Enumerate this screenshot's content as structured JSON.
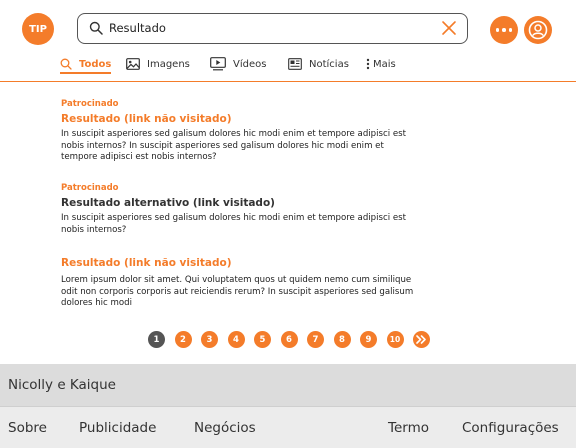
{
  "header": {
    "logo_text": "TIP",
    "search": {
      "value": "Resultado"
    }
  },
  "tabs": [
    {
      "label": "Todos",
      "icon": "search-icon",
      "active": true
    },
    {
      "label": "Imagens",
      "icon": "image-icon",
      "active": false
    },
    {
      "label": "Vídeos",
      "icon": "video-icon",
      "active": false
    },
    {
      "label": "Notícias",
      "icon": "news-icon",
      "active": false
    },
    {
      "label": "Mais",
      "icon": "kebab-icon",
      "active": false
    }
  ],
  "results": [
    {
      "sponsored": "Patrocinado",
      "title": "Resultado (link não visitado)",
      "description": "In suscipit asperiores sed galisum dolores hic modi enim et tempore adipisci est nobis internos? In suscipit asperiores sed galisum dolores hic modi enim et tempore adipisci est nobis internos?"
    },
    {
      "sponsored": "Patrocinado",
      "title": "Resultado alternativo (link visitado)",
      "description": "In suscipit asperiores sed galisum dolores hic modi enim et tempore adipisci est nobis internos?"
    },
    {
      "sponsored": "",
      "title": "Resultado (link não visitado)",
      "description": "Lorem ipsum dolor sit amet. Qui voluptatem quos ut quidem nemo cum similique odit non corporis corporis aut reiciendis rerum? In suscipit asperiores sed galisum dolores hic modi"
    }
  ],
  "pagination": {
    "pages": [
      "1",
      "2",
      "3",
      "4",
      "5",
      "6",
      "7",
      "8",
      "9",
      "10"
    ],
    "current": "1",
    "next_icon": "double-chevron-right-icon"
  },
  "footer": {
    "region": "Nicolly e Kaique",
    "links": [
      "Sobre",
      "Publicidade",
      "Negócios",
      "Termo",
      "Configurações"
    ]
  },
  "colors": {
    "accent": "#f47c2a",
    "current_page": "#555555",
    "footer_top": "#dcdcdc",
    "footer_bottom": "#ececec"
  }
}
